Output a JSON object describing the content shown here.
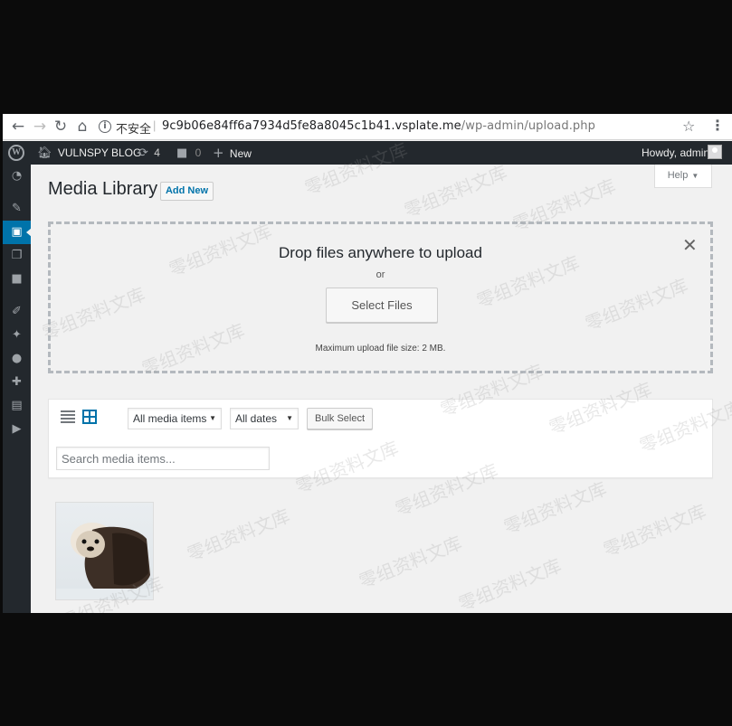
{
  "browser": {
    "insecure_label": "不安全",
    "url_host": "9c9b06e84ff6a7934d5fe8a8045c1b41.vsplate.me",
    "url_path": "/wp-admin/upload.php"
  },
  "admin_bar": {
    "site_name": "VULNSPY BLOG",
    "updates_count": "4",
    "comments_count": "0",
    "new_label": "New",
    "howdy": "Howdy, admin"
  },
  "page": {
    "title": "Media Library",
    "add_new_label": "Add New",
    "help_label": "Help"
  },
  "uploader": {
    "drop_title": "Drop files anywhere to upload",
    "or_text": "or",
    "select_files_label": "Select Files",
    "max_size": "Maximum upload file size: 2 MB."
  },
  "filters": {
    "media_type": "All media items",
    "dates": "All dates",
    "bulk_select_label": "Bulk Select",
    "search_placeholder": "Search media items..."
  },
  "watermark_text": "零组资料文库",
  "colors": {
    "admin_bar": "#23282d",
    "accent": "#0073aa",
    "background": "#f1f1f1"
  }
}
